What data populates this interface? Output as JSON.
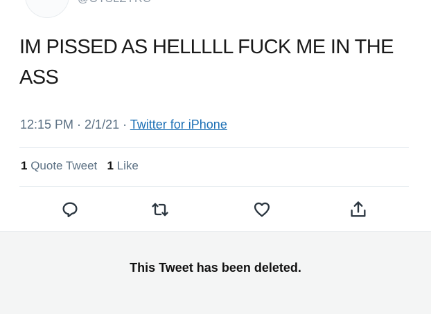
{
  "header": {
    "handle": "@OTSLZYRC"
  },
  "tweet": {
    "text": "IM PISSED AS HELLLLL FUCK ME IN THE ASS",
    "time": "12:15 PM",
    "separator": " · ",
    "date": "2/1/21",
    "source": "Twitter for iPhone"
  },
  "stats": {
    "quote_tweets_count": "1",
    "quote_tweets_label": "Quote Tweet",
    "likes_count": "1",
    "likes_label": "Like"
  },
  "actions": [
    {
      "name": "reply",
      "icon": "reply-icon"
    },
    {
      "name": "retweet",
      "icon": "retweet-icon"
    },
    {
      "name": "like",
      "icon": "heart-icon"
    },
    {
      "name": "share",
      "icon": "share-icon"
    }
  ],
  "notice": {
    "text": "This Tweet has been deleted."
  },
  "colors": {
    "link": "#1b6fb5",
    "muted": "#5b7083",
    "panel_bg": "#f4f5f5"
  }
}
